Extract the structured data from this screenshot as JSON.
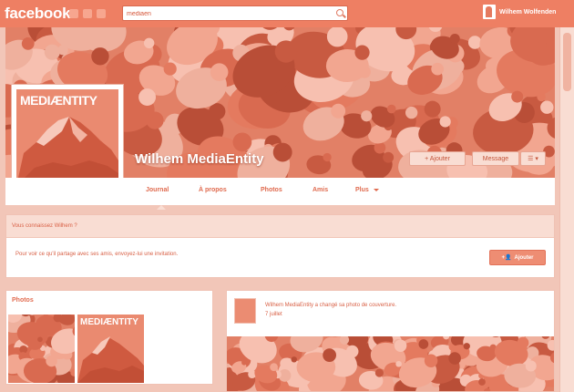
{
  "topbar": {
    "logo": "facebook",
    "search_value": "mediaen",
    "account_name": "Wilhem Wolfenden"
  },
  "profile": {
    "name": "Wilhem MediaEntity",
    "picture_brand": "MEDIÆNTITY",
    "add_friend_button": "+ Ajouter",
    "message_button": "Message",
    "more_button": "☰ ▾"
  },
  "nav": {
    "tabs": [
      "Journal",
      "À propos",
      "Photos",
      "Amis",
      "Plus"
    ]
  },
  "friend_prompt": {
    "header": "Vous connaissez Wilhem ?",
    "text": "Pour voir ce qu'il partage avec ses amis, envoyez-lui une invitation.",
    "add_button": "Ajouter"
  },
  "photos": {
    "title": "Photos",
    "thumb2_brand": "MEDIÆNTITY"
  },
  "post": {
    "text_line1": "Wilhem MediaEntity a changé sa photo de couverture.",
    "text_line2": "7 juillet"
  },
  "colors": {
    "brand": "#ee7f63",
    "background": "#f2c6b8",
    "cover": "#e98469"
  }
}
